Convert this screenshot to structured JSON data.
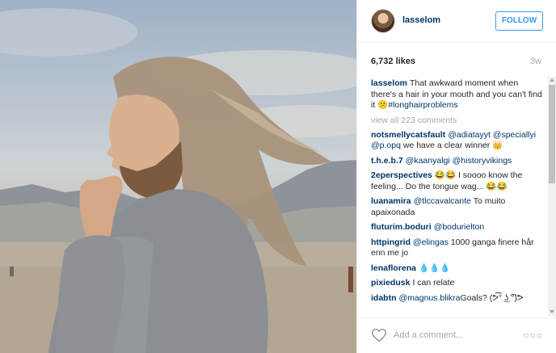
{
  "post": {
    "username": "lasselom",
    "follow_label": "FOLLOW",
    "likes": "6,732 likes",
    "age": "3w",
    "caption_user": "lasselom",
    "caption_text": "That awkward moment when there's a hair in your mouth and you can't find it 😕",
    "caption_hashtag": "#longhairproblems",
    "view_all": "view all 223 comments",
    "add_comment_placeholder": "Add a comment...",
    "more_label": "○○○"
  },
  "comments": [
    {
      "user": "notsmellycatsfault",
      "mention": "@adiatayyt @speciallyi @p.opq",
      "text": " we have a clear winner 👑"
    },
    {
      "user": "t.h.e.b.7",
      "mention": "@kaanyalgi @historyvikings",
      "text": ""
    },
    {
      "user": "2eperspectives",
      "mention": "",
      "text": "😂😂 I soooo know the feeling... Do the tongue wag... 😂😂"
    },
    {
      "user": "luanamira",
      "mention": "@tlccavalcante",
      "text": " To muito apaixonada"
    },
    {
      "user": "fluturim.boduri",
      "mention": "@bodurielton",
      "text": ""
    },
    {
      "user": "httpingrid",
      "mention": "@elingas",
      "text": " 1000 ganga finere hår enn me jo"
    },
    {
      "user": "lenaflorena",
      "mention": "",
      "text": "💧💧💧"
    },
    {
      "user": "pixiedusk",
      "mention": "",
      "text": "I can relate"
    },
    {
      "user": "idabtn",
      "mention": "@magnus.blikra",
      "text": "Goals? (ᕗ͡° ͜ʖ ͡°)ᕗ "
    }
  ]
}
